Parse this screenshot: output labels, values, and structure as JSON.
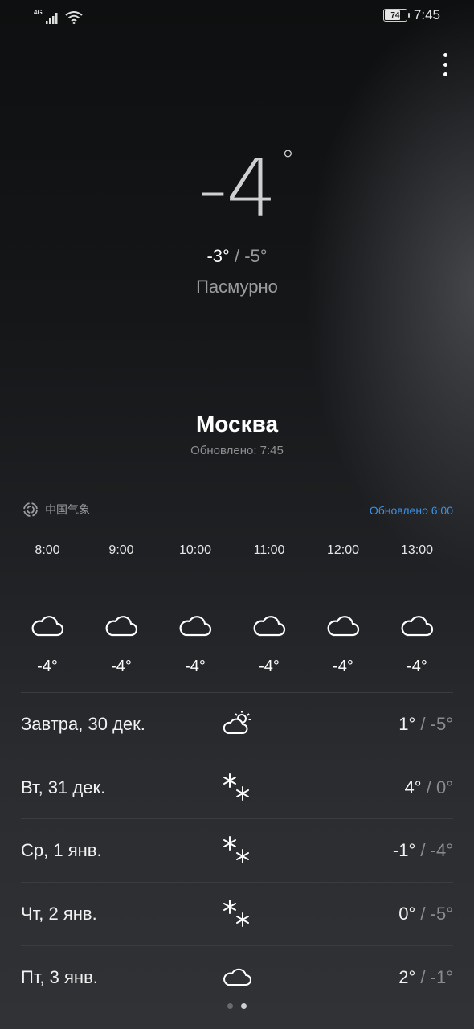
{
  "status_bar": {
    "network": "4G",
    "battery": "74",
    "battery_fraction": 0.74,
    "time": "7:45"
  },
  "current": {
    "temperature": "-4",
    "degree": "°",
    "high": "-3°",
    "separator": "/",
    "low": "-5°",
    "condition": "Пасмурно",
    "city": "Москва",
    "updated": "Обновлено: 7:45"
  },
  "source": {
    "name": "中国气象",
    "updated": "Обновлено 6:00"
  },
  "hourly": [
    {
      "time": "8:00",
      "icon": "cloud-icon",
      "temp": "-4°"
    },
    {
      "time": "9:00",
      "icon": "cloud-icon",
      "temp": "-4°"
    },
    {
      "time": "10:00",
      "icon": "cloud-icon",
      "temp": "-4°"
    },
    {
      "time": "11:00",
      "icon": "cloud-icon",
      "temp": "-4°"
    },
    {
      "time": "12:00",
      "icon": "cloud-icon",
      "temp": "-4°"
    },
    {
      "time": "13:00",
      "icon": "cloud-icon",
      "temp": "-4°"
    }
  ],
  "daily": [
    {
      "label": "Завтра, 30 дек.",
      "icon": "partly-cloudy-icon",
      "high": "1°",
      "separator": "/",
      "low": "-5°"
    },
    {
      "label": "Вт, 31 дек.",
      "icon": "snow-icon",
      "high": "4°",
      "separator": "/",
      "low": "0°"
    },
    {
      "label": "Ср, 1 янв.",
      "icon": "snow-icon",
      "high": "-1°",
      "separator": "/",
      "low": "-4°"
    },
    {
      "label": "Чт, 2 янв.",
      "icon": "snow-icon",
      "high": "0°",
      "separator": "/",
      "low": "-5°"
    },
    {
      "label": "Пт, 3 янв.",
      "icon": "cloud-icon",
      "high": "2°",
      "separator": "/",
      "low": "-1°"
    }
  ],
  "pager": {
    "pages": 2,
    "active": 1
  },
  "colors": {
    "accent": "#3d8fe0",
    "text_primary": "#ffffff",
    "text_secondary": "#8a8b8e"
  }
}
